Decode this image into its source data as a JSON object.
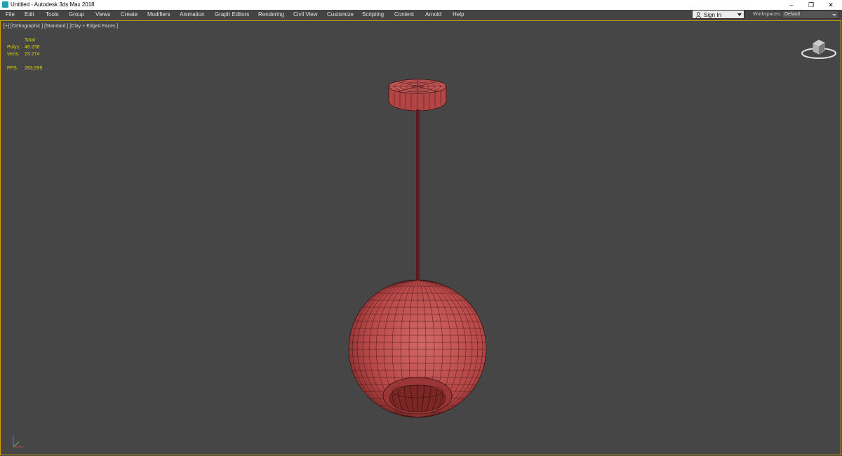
{
  "window": {
    "title": "Untitled - Autodesk 3ds Max 2018",
    "controls": {
      "minimize": "–",
      "restore": "❐",
      "close": "✕"
    }
  },
  "menu": {
    "items": [
      "File",
      "Edit",
      "Tools",
      "Group",
      "Views",
      "Create",
      "Modifiers",
      "Animation",
      "Graph Editors",
      "Rendering",
      "Civil View",
      "Customize",
      "Scripting",
      "Content",
      "Arnold",
      "Help"
    ]
  },
  "account": {
    "sign_in_label": "Sign In"
  },
  "workspaces": {
    "label": "Workspaces:",
    "value": "Default"
  },
  "viewport": {
    "label": "[+] [Orthographic ] [Standard ] [Clay + Edged Faces ]",
    "stats": {
      "header": "Total",
      "polys_label": "Polys:",
      "polys_value": "46 238",
      "verts_label": "Verts:",
      "verts_value": "23 274",
      "fps_label": "FPS:",
      "fps_value": "283,599"
    },
    "border_color": "#c8a400",
    "stats_color": "#d7d300",
    "model_color": "#b84848"
  }
}
